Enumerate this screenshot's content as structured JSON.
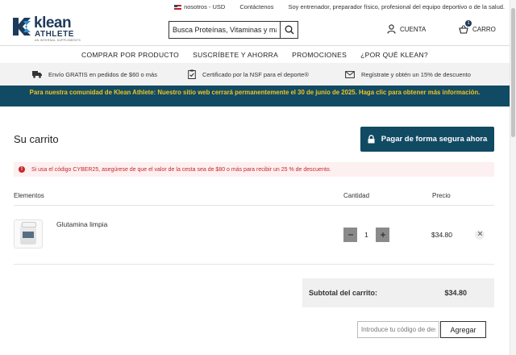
{
  "topbar": {
    "region": "nosotros - USD",
    "contact": "Contáctenos",
    "audience": "Soy entrenador, preparador físico, profesional del equipo deportivo o de la salud."
  },
  "brand": {
    "name_top": "klean",
    "name_bottom": "ATHLETE",
    "tagline": "AN INTERNAL SUPPLEMENTS",
    "color": "#1d3a5a"
  },
  "search": {
    "placeholder": "Busca Proteínas, Vitaminas y más",
    "icon": "search-icon"
  },
  "header": {
    "account_label": "CUENTA",
    "cart_label": "CARRO",
    "cart_count": "1"
  },
  "nav": {
    "items": [
      "COMPRAR POR PRODUCTO",
      "SUSCRÍBETE Y AHORRA",
      "PROMOCIONES",
      "¿POR QUÉ KLEAN?"
    ]
  },
  "perks": [
    {
      "icon": "truck-icon",
      "text": "Envío GRATIS en pedidos de $60 o más"
    },
    {
      "icon": "clipboard-check-icon",
      "text": "Certificado por la NSF para el deporte®"
    },
    {
      "icon": "mail-icon",
      "text": "Regístrate y obtén un 15% de descuento"
    }
  ],
  "banner": {
    "text": "Para nuestra comunidad de Klean Athlete: Nuestro sitio web cerrará permanentemente el 30 de junio de 2025. Haga clic para obtener más información.",
    "bg_color": "#114a63",
    "text_color": "#f3c321"
  },
  "cart": {
    "title": "Su carrito",
    "checkout_label": "Pagar de forma segura ahora",
    "alert": "Si usa el código CYBER25, asegúrese de que el valor de la cesta sea de $80 o más para recibir un 25 % de descuento.",
    "columns": {
      "items": "Elementos",
      "quantity": "Cantidad",
      "price": "Precio"
    },
    "items": [
      {
        "name": "Glutamina limpia",
        "quantity": "1",
        "price": "$34.80"
      }
    ],
    "subtotal_label": "Subtotal del carrito:",
    "subtotal_value": "$34.80",
    "promo_placeholder": "Introduce tu código de descuento",
    "apply_label": "Agregar"
  }
}
